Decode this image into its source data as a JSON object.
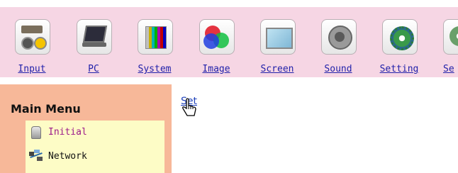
{
  "toolbar": {
    "items": [
      {
        "label": "Input",
        "icon": "input-connectors-icon"
      },
      {
        "label": "PC",
        "icon": "laptop-icon"
      },
      {
        "label": "System",
        "icon": "color-bars-icon"
      },
      {
        "label": "Image",
        "icon": "rgb-circles-icon"
      },
      {
        "label": "Screen",
        "icon": "screen-icon"
      },
      {
        "label": "Sound",
        "icon": "speaker-icon"
      },
      {
        "label": "Setting",
        "icon": "gear-icon"
      },
      {
        "label": "Se",
        "icon": "partial-icon"
      }
    ]
  },
  "sidebar": {
    "title": "Main Menu",
    "items": [
      {
        "label": "Initial",
        "icon": "lock-icon",
        "color": "#9b1a8a"
      },
      {
        "label": "Network",
        "icon": "network-icon",
        "color": "#111111"
      }
    ]
  },
  "main": {
    "link_label": "Set"
  },
  "colors": {
    "toolbar_bg": "#f6d6e4",
    "sidebar_bg": "#f7b899",
    "menu_list_bg": "#fdfcc6",
    "link_blue": "#2222aa"
  }
}
